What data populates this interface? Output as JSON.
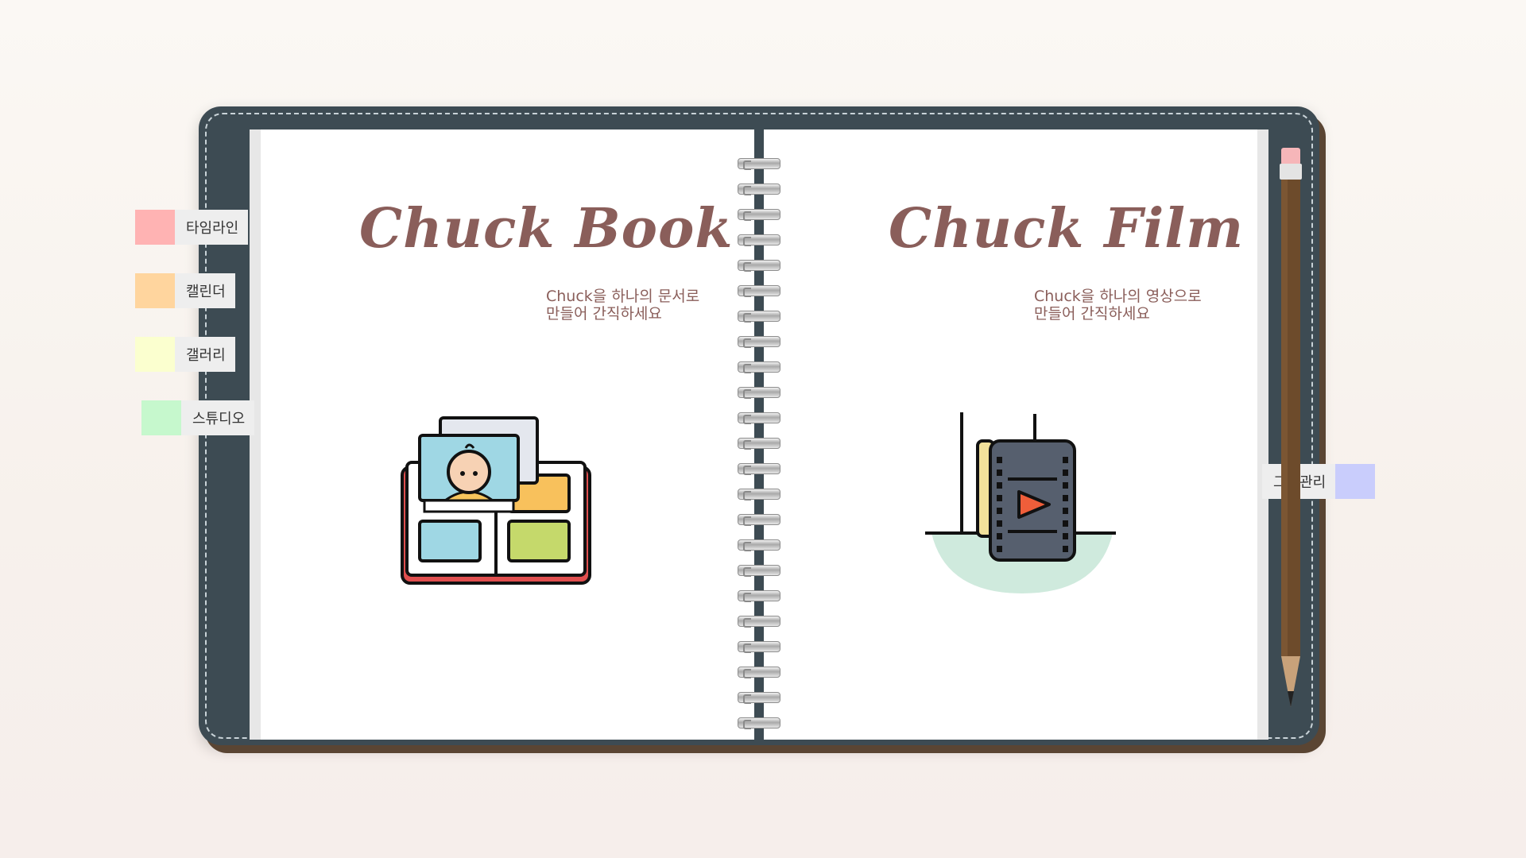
{
  "left_page": {
    "title": "Chuck Book",
    "subtitle_line1": "Chuck을 하나의 문서로",
    "subtitle_line2": "만들어 간직하세요"
  },
  "right_page": {
    "title": "Chuck Film",
    "subtitle_line1": "Chuck을 하나의 영상으로",
    "subtitle_line2": "만들어 간직하세요"
  },
  "left_tabs": [
    {
      "label": "타임라인",
      "color": "#ffb3b3"
    },
    {
      "label": "캘린더",
      "color": "#ffd59e"
    },
    {
      "label": "갤러리",
      "color": "#fbffcf"
    },
    {
      "label": "스튜디오",
      "color": "#c6f8cd"
    }
  ],
  "right_tab": {
    "label": "그룹관리",
    "color": "#c9cdfc"
  },
  "icons": {
    "book": "photo-album-icon",
    "film": "film-reel-icon",
    "pencil": "pencil-icon"
  }
}
